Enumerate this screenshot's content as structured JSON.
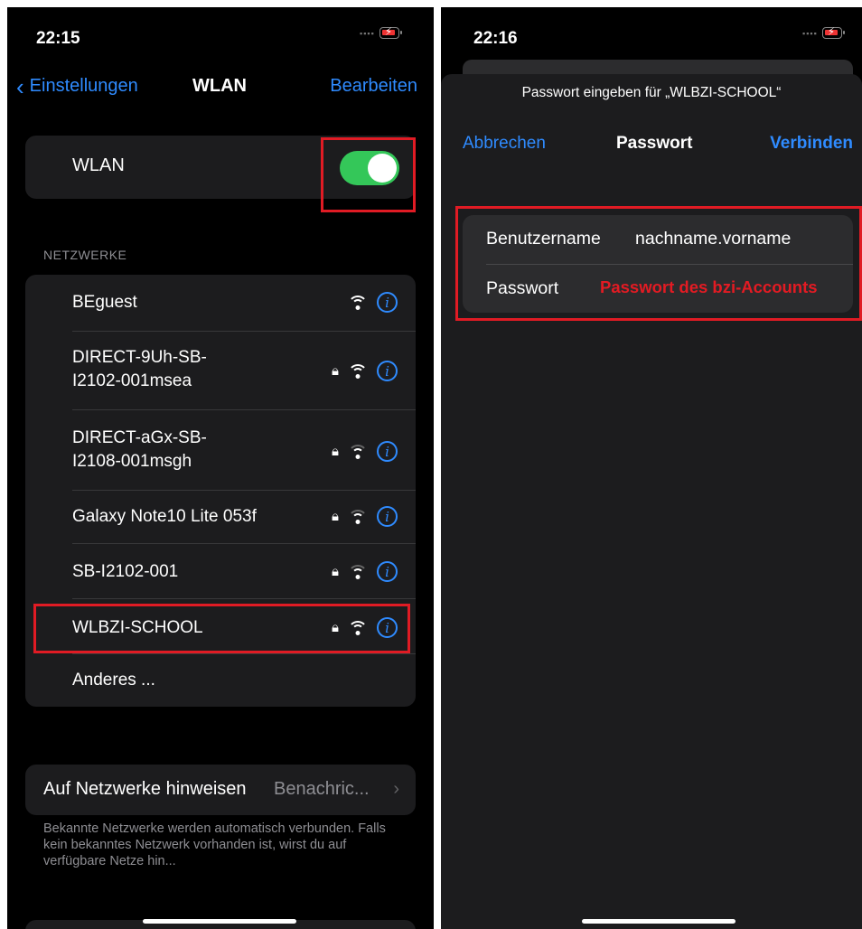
{
  "left": {
    "status": {
      "time": "22:15"
    },
    "nav": {
      "back_label": "Einstellungen",
      "title": "WLAN",
      "edit_label": "Bearbeiten"
    },
    "wlan_toggle": {
      "label": "WLAN",
      "on": true,
      "accent": "#34c759"
    },
    "networks_header": "NETZWERKE",
    "networks": [
      {
        "name": "BEguest",
        "locked": false,
        "signal": "strong"
      },
      {
        "name": "DIRECT-9Uh-SB-I2102-001msea",
        "line1": "DIRECT-9Uh-SB-",
        "line2": "I2102-001msea",
        "locked": true,
        "signal": "strong"
      },
      {
        "name": "DIRECT-aGx-SB-I2108-001msgh",
        "line1": "DIRECT-aGx-SB-",
        "line2": "I2108-001msgh",
        "locked": true,
        "signal": "weak"
      },
      {
        "name": "Galaxy Note10 Lite 053f",
        "locked": true,
        "signal": "weak"
      },
      {
        "name": "SB-I2102-001",
        "locked": true,
        "signal": "weak"
      },
      {
        "name": "WLBZI-SCHOOL",
        "locked": true,
        "signal": "strong"
      }
    ],
    "other_label": "Anderes ...",
    "notify": {
      "label": "Auf Netzwerke hinweisen",
      "value": "Benachric..."
    },
    "footnote": "Bekannte Netzwerke werden automatisch verbunden. Falls kein bekanntes Netzwerk vorhanden ist, wirst du auf verfügbare Netze hin..."
  },
  "right": {
    "status": {
      "time": "22:16"
    },
    "prompt": "Passwort eingeben für „WLBZI-SCHOOL“",
    "cancel_label": "Abbrechen",
    "title": "Passwort",
    "connect_label": "Verbinden",
    "username_label": "Benutzername",
    "username_value": "nachname.vorname",
    "password_label": "Passwort",
    "password_annotation": "Passwort des bzi-Accounts"
  },
  "colors": {
    "accent_blue": "#2f8bff",
    "highlight_red": "#e01b24",
    "annotation_red": "#e31b23"
  }
}
